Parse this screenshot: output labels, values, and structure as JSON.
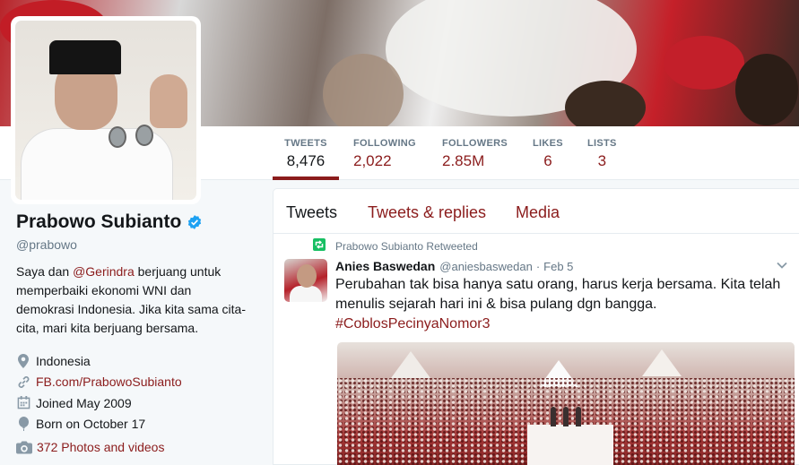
{
  "stats": [
    {
      "label": "TWEETS",
      "value": "8,476"
    },
    {
      "label": "FOLLOWING",
      "value": "2,022"
    },
    {
      "label": "FOLLOWERS",
      "value": "2.85M"
    },
    {
      "label": "LIKES",
      "value": "6"
    },
    {
      "label": "LISTS",
      "value": "3"
    }
  ],
  "profile": {
    "name": "Prabowo Subianto",
    "handle": "@prabowo",
    "bio_pre": "Saya dan ",
    "bio_mention": "@Gerindra",
    "bio_post": " berjuang untuk memperbaiki ekonomi WNI dan demokrasi Indonesia. Jika kita sama cita-cita, mari kita berjuang bersama.",
    "location": "Indonesia",
    "website": "FB.com/PrabowoSubianto",
    "joined": "Joined May 2009",
    "born": "Born on October 17",
    "photos": "372 Photos and videos"
  },
  "timeline_tabs": [
    "Tweets",
    "Tweets & replies",
    "Media"
  ],
  "tweet": {
    "retweeted_by": "Prabowo Subianto Retweeted",
    "author_name": "Anies Baswedan",
    "author_handle": "@aniesbaswedan",
    "separator": "·",
    "date": "Feb 5",
    "text": "Perubahan tak bisa hanya satu orang, harus kerja bersama. Kita telah menulis sejarah hari ini & bisa pulang dgn bangga.",
    "hashtag": "#CoblosPecinyaNomor3"
  },
  "colors": {
    "accent": "#8b1c1c",
    "verified": "#1da1f2",
    "retweet": "#17bf63"
  }
}
